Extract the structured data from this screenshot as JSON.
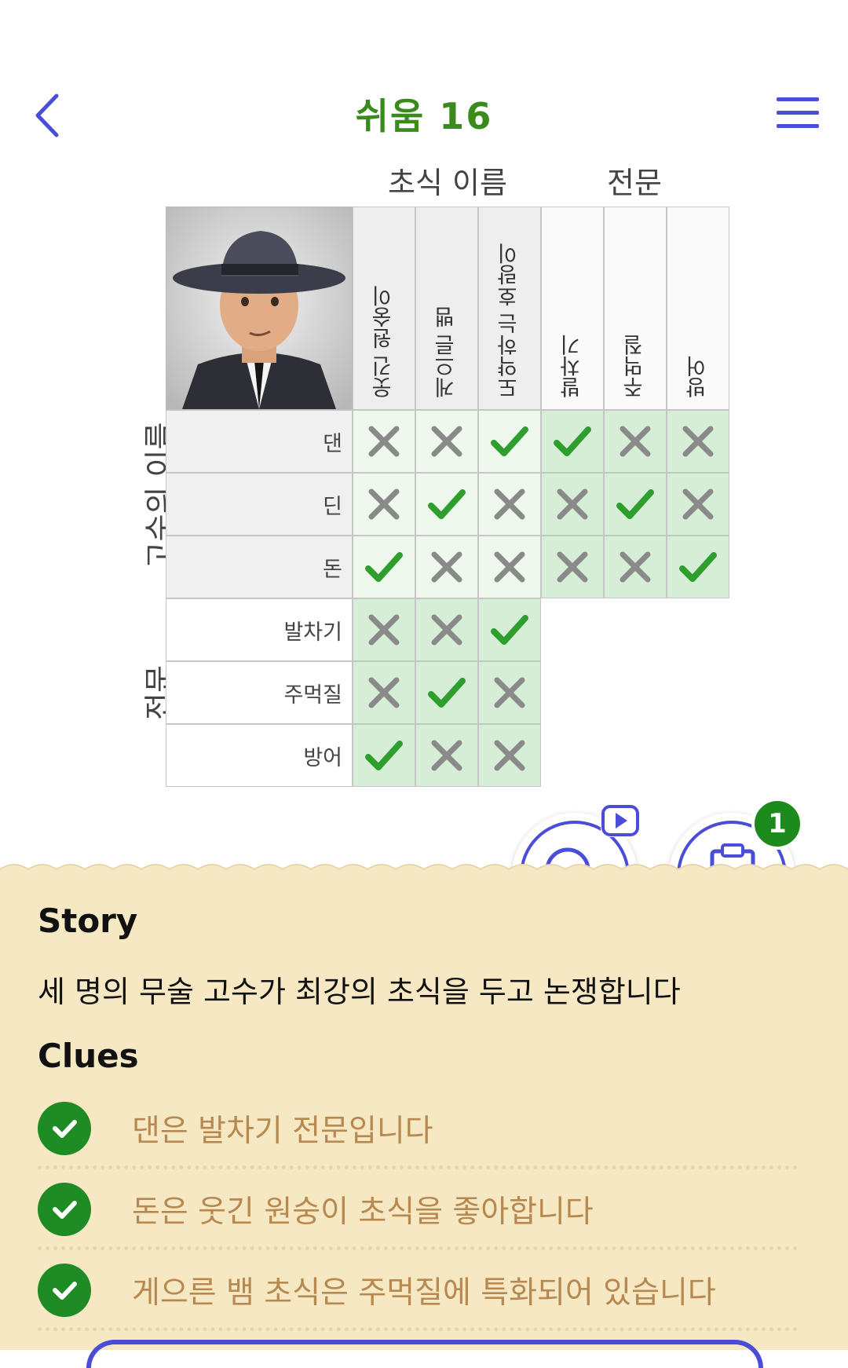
{
  "header": {
    "title": "쉬움 16"
  },
  "groups": {
    "top": [
      "초식 이름",
      "전문"
    ],
    "left": [
      "고수의 이름",
      "전문"
    ]
  },
  "columns": [
    "웃긴 원숭이",
    "게으른 뱀",
    "도약하는 호랑이",
    "발차기",
    "주먹질",
    "방어"
  ],
  "rows": [
    "댄",
    "딘",
    "돈",
    "발차기",
    "주먹질",
    "방어"
  ],
  "grid": [
    [
      "x",
      "x",
      "check",
      "check",
      "x",
      "x"
    ],
    [
      "x",
      "check",
      "x",
      "x",
      "check",
      "x"
    ],
    [
      "check",
      "x",
      "x",
      "x",
      "x",
      "check"
    ],
    [
      "x",
      "x",
      "check"
    ],
    [
      "x",
      "check",
      "x"
    ],
    [
      "check",
      "x",
      "x"
    ]
  ],
  "buttons": {
    "hint_icon": "magnifier-icon",
    "clipboard_icon": "clipboard-check-icon",
    "clipboard_badge": "1"
  },
  "story": {
    "heading": "Story",
    "text": "세 명의 무술 고수가 최강의 초식을 두고 논쟁합니다"
  },
  "clues": {
    "heading": "Clues",
    "items": [
      "댄은 발차기 전문입니다",
      "돈은 웃긴 원숭이 초식을 좋아합니다",
      "게으른 뱀 초식은 주먹질에 특화되어 있습니다"
    ]
  },
  "colors": {
    "accent": "#4a4ed6",
    "title": "#3a8a1c",
    "check": "#2e9e2e",
    "cross": "#8a8a8a",
    "panel": "#f6e8c3",
    "clue_text": "#b7884f"
  }
}
